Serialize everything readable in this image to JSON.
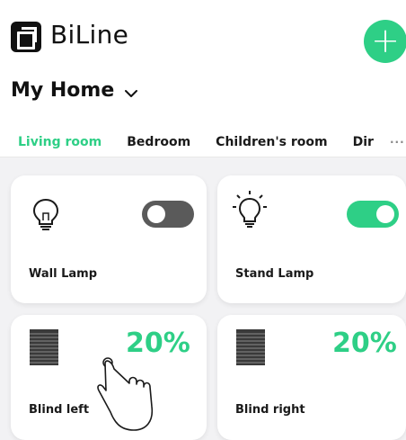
{
  "app": {
    "name": "BiLine"
  },
  "home": {
    "title": "My Home"
  },
  "tabs": [
    {
      "label": "Living room",
      "active": true
    },
    {
      "label": "Bedroom",
      "active": false
    },
    {
      "label": "Children's room",
      "active": false
    },
    {
      "label": "Dir",
      "active": false
    }
  ],
  "more_label": "···",
  "devices": [
    {
      "name": "Wall Lamp",
      "type": "light",
      "on": false,
      "icon": "bulb-icon"
    },
    {
      "name": "Stand Lamp",
      "type": "light",
      "on": true,
      "icon": "bulb-lit-icon"
    },
    {
      "name": "Blind left",
      "type": "blind",
      "level": "20%",
      "icon": "blind-icon"
    },
    {
      "name": "Blind right",
      "type": "blind",
      "level": "20%",
      "icon": "blind-icon"
    }
  ],
  "colors": {
    "accent": "#2ecf86",
    "toggle_off": "#5a5a5a",
    "background": "#f2f2f4"
  },
  "overlay": {
    "icon": "tap-hand-cursor-icon"
  }
}
